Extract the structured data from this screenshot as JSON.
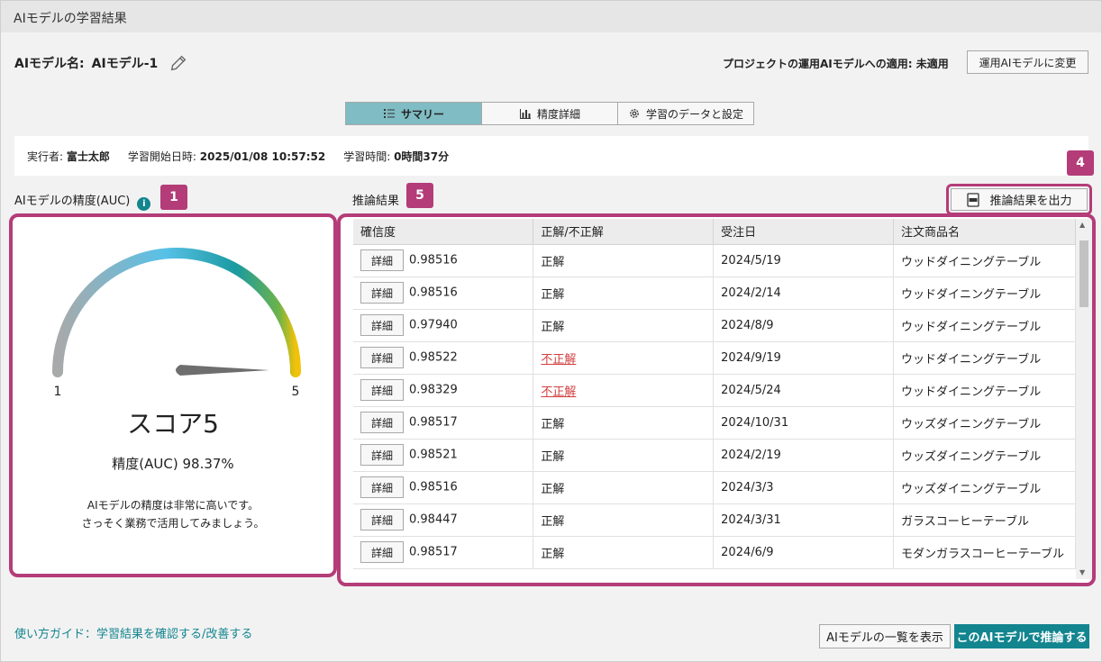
{
  "window": {
    "title": "AIモデルの学習結果"
  },
  "model": {
    "label": "AIモデル名:",
    "name": "AIモデル-1"
  },
  "apply": {
    "status": "プロジェクトの運用AIモデルへの適用: 未適用",
    "change_button": "運用AIモデルに変更"
  },
  "tabs": [
    {
      "label": "サマリー",
      "icon": "list-icon",
      "active": true
    },
    {
      "label": "精度詳細",
      "icon": "bar-chart-icon",
      "active": false
    },
    {
      "label": "学習のデータと設定",
      "icon": "gear-icon",
      "active": false
    }
  ],
  "info": {
    "executor_label": "実行者:",
    "executor": "富士太郎",
    "start_label": "学習開始日時:",
    "start": "2025/01/08 10:57:52",
    "duration_label": "学習時間:",
    "duration": "0時間37分"
  },
  "accuracy": {
    "label": "AIモデルの精度(AUC)",
    "badge": "1",
    "gauge_min": "1",
    "gauge_max": "5",
    "gauge_level": 5,
    "score": "スコア5",
    "auc": "精度(AUC) 98.37%",
    "message_line1": "AIモデルの精度は非常に高いです。",
    "message_line2": "さっそく業務で活用してみましょう。"
  },
  "results": {
    "label": "推論結果",
    "badge": "5",
    "export_badge": "4",
    "export_button": "推論結果を出力",
    "columns": [
      "確信度",
      "正解/不正解",
      "受注日",
      "注文商品名"
    ],
    "detail_label": "詳細",
    "rows": [
      {
        "confidence": "0.98516",
        "result": "正解",
        "ok": true,
        "date": "2024/5/19",
        "product": "ウッドダイニングテーブル"
      },
      {
        "confidence": "0.98516",
        "result": "正解",
        "ok": true,
        "date": "2024/2/14",
        "product": "ウッドダイニングテーブル"
      },
      {
        "confidence": "0.97940",
        "result": "正解",
        "ok": true,
        "date": "2024/8/9",
        "product": "ウッドダイニングテーブル"
      },
      {
        "confidence": "0.98522",
        "result": "不正解",
        "ok": false,
        "date": "2024/9/19",
        "product": "ウッドダイニングテーブル"
      },
      {
        "confidence": "0.98329",
        "result": "不正解",
        "ok": false,
        "date": "2024/5/24",
        "product": "ウッドダイニングテーブル"
      },
      {
        "confidence": "0.98517",
        "result": "正解",
        "ok": true,
        "date": "2024/10/31",
        "product": "ウッズダイニングテーブル"
      },
      {
        "confidence": "0.98521",
        "result": "正解",
        "ok": true,
        "date": "2024/2/19",
        "product": "ウッズダイニングテーブル"
      },
      {
        "confidence": "0.98516",
        "result": "正解",
        "ok": true,
        "date": "2024/3/3",
        "product": "ウッズダイニングテーブル"
      },
      {
        "confidence": "0.98447",
        "result": "正解",
        "ok": true,
        "date": "2024/3/31",
        "product": "ガラスコーヒーテーブル"
      },
      {
        "confidence": "0.98517",
        "result": "正解",
        "ok": true,
        "date": "2024/6/9",
        "product": "モダンガラスコーヒーテーブル"
      }
    ]
  },
  "footer": {
    "guide": "使い方ガイド：学習結果を確認する/改善する",
    "list_button": "AIモデルの一覧を表示",
    "infer_button": "このAIモデルで推論する"
  },
  "colors": {
    "accent": "#13858f",
    "highlight": "#b43c78",
    "tab_active": "#7fbcc3",
    "error": "#d23f3f"
  }
}
